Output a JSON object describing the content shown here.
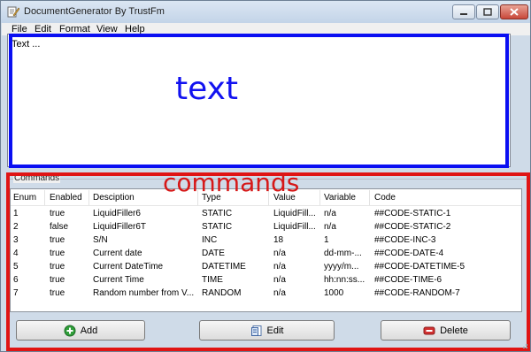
{
  "window": {
    "title": "DocumentGenerator By TrustFm"
  },
  "menu": [
    "File",
    "Edit",
    "Format",
    "View",
    "Help"
  ],
  "editor": {
    "value": "Text ..."
  },
  "annotations": {
    "text_label": "text",
    "commands_label": "commands"
  },
  "commands": {
    "group_label": "Commands",
    "columns": [
      "Enum",
      "Enabled",
      "Desciption",
      "Type",
      "Value",
      "Variable",
      "Code"
    ],
    "rows": [
      [
        "1",
        "true",
        "LiquidFiller6",
        "STATIC",
        "LiquidFill...",
        "n/a",
        "##CODE-STATIC-1"
      ],
      [
        "2",
        "false",
        "LiquidFiller6T",
        "STATIC",
        "LiquidFill...",
        "n/a",
        "##CODE-STATIC-2"
      ],
      [
        "3",
        "true",
        "S/N",
        "INC",
        "18",
        "1",
        "##CODE-INC-3"
      ],
      [
        "4",
        "true",
        "Current date",
        "DATE",
        "n/a",
        "dd-mm-...",
        "##CODE-DATE-4"
      ],
      [
        "5",
        "true",
        "Current DateTime",
        "DATETIME",
        "n/a",
        "yyyy/m...",
        "##CODE-DATETIME-5"
      ],
      [
        "6",
        "true",
        "Current Time",
        "TIME",
        "n/a",
        "hh:nn:ss...",
        "##CODE-TIME-6"
      ],
      [
        "7",
        "true",
        "Random number from V...",
        "RANDOM",
        "n/a",
        "1000",
        "##CODE-RANDOM-7"
      ]
    ]
  },
  "buttons": {
    "add": "Add",
    "edit": "Edit",
    "delete": "Delete"
  },
  "colors": {
    "annotation_blue": "#0a0ff2",
    "annotation_red": "#e01414"
  }
}
